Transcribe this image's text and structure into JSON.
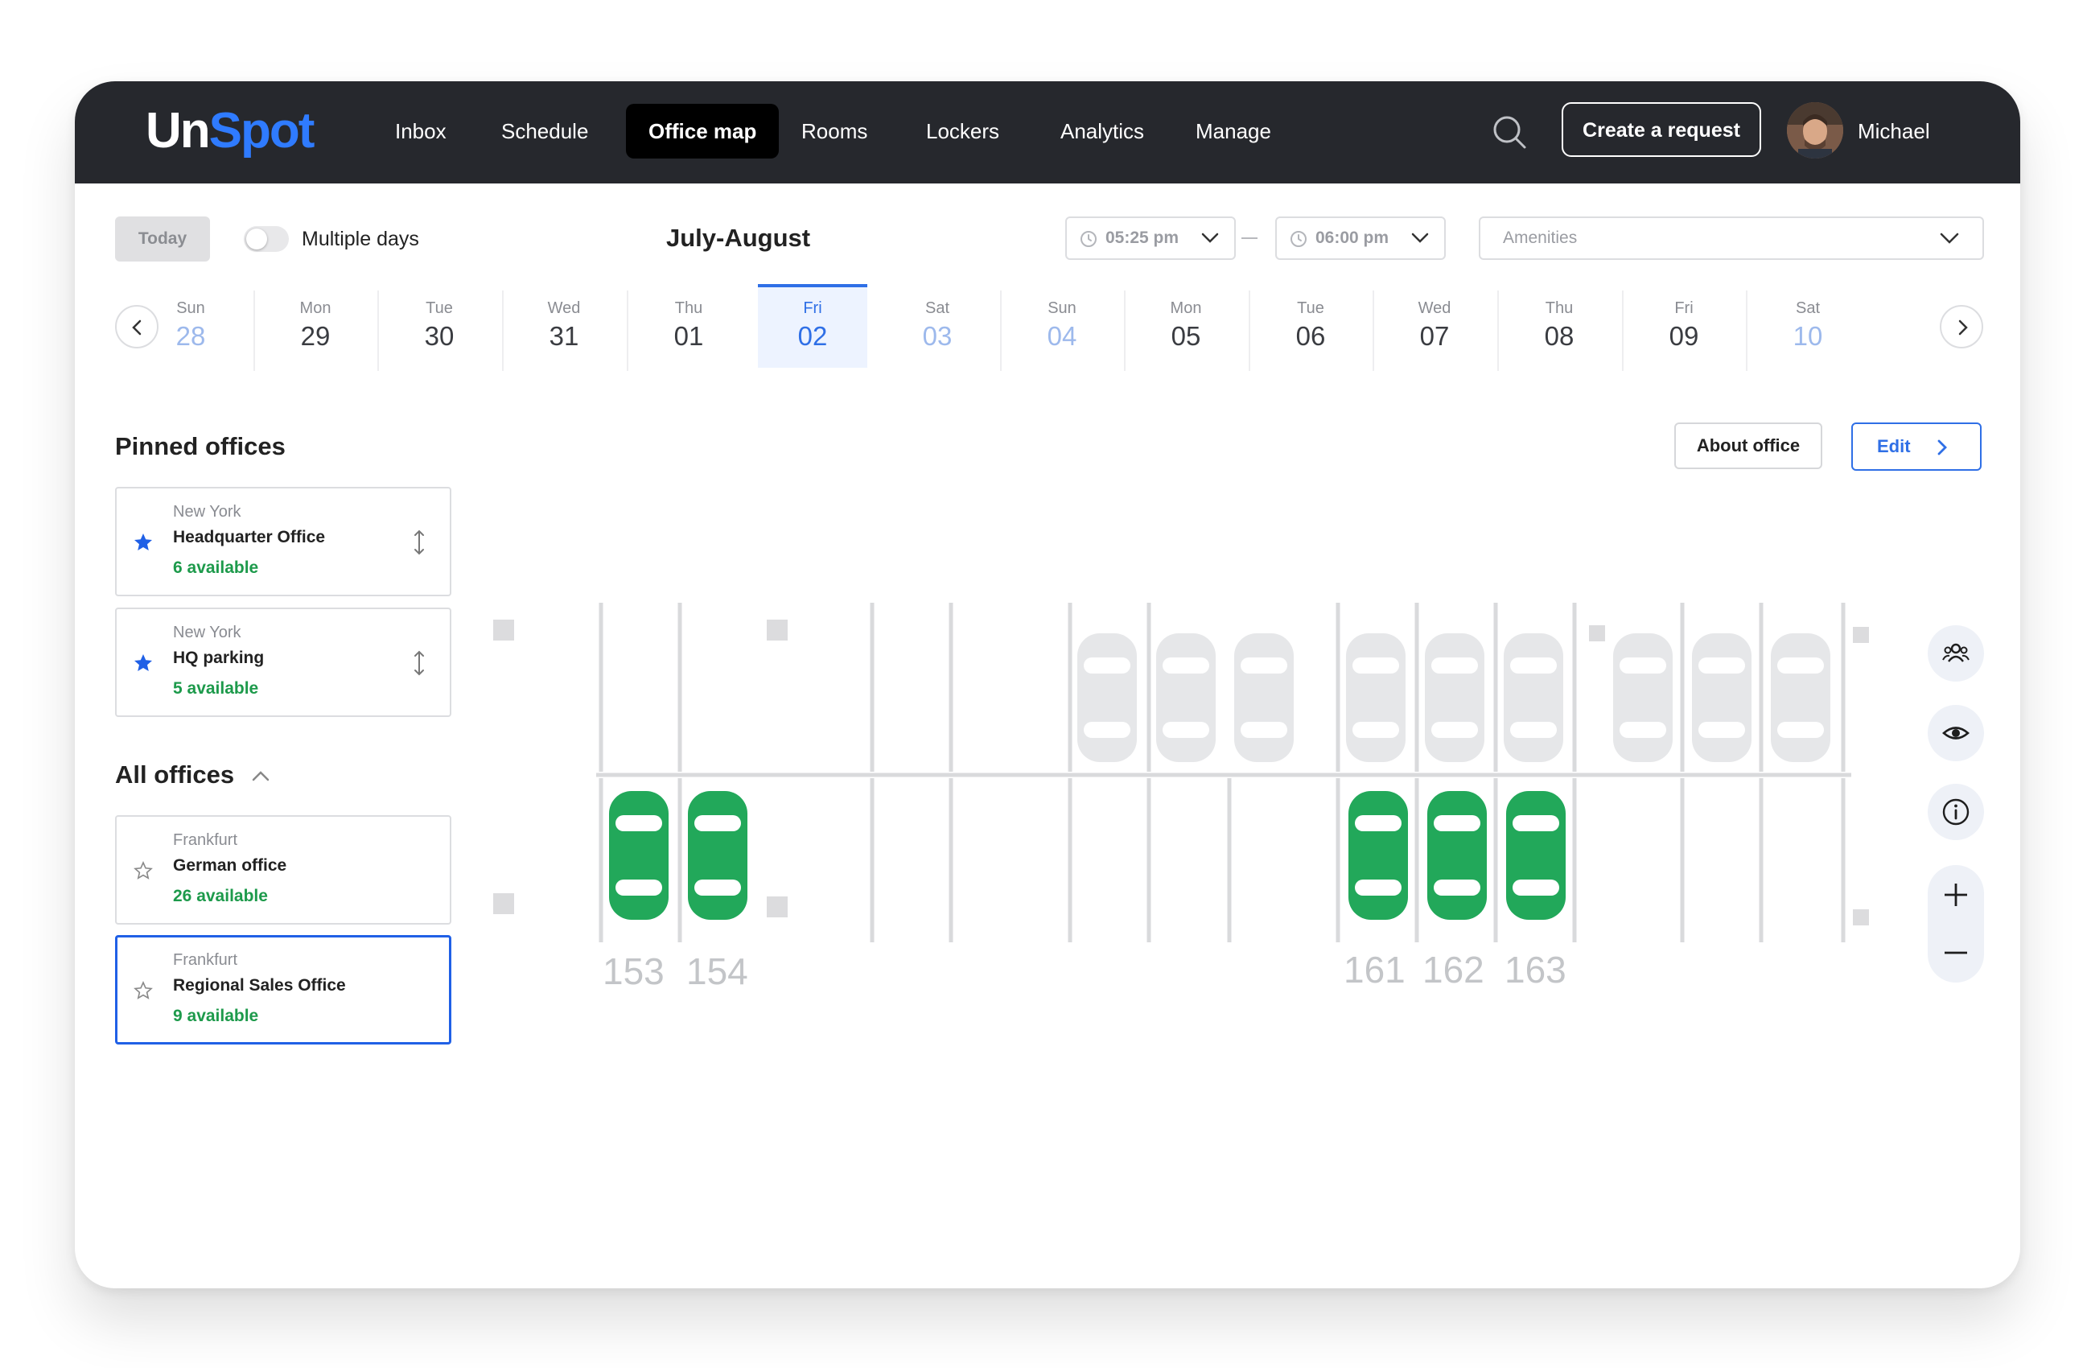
{
  "header": {
    "logo_un": "Un",
    "logo_spot": "Spot",
    "nav": [
      {
        "label": "Inbox"
      },
      {
        "label": "Schedule"
      },
      {
        "label": "Office map"
      },
      {
        "label": "Rooms"
      },
      {
        "label": "Lockers"
      },
      {
        "label": "Analytics"
      },
      {
        "label": "Manage"
      }
    ],
    "active_nav": "Office map",
    "create_label": "Create a request",
    "user_name": "Michael"
  },
  "toolbar": {
    "today_label": "Today",
    "multiple_days_label": "Multiple days",
    "multiple_days_on": false,
    "month_label": "July-August",
    "time_from": "05:25 pm",
    "time_to": "06:00 pm",
    "amenities_placeholder": "Amenities"
  },
  "dates": [
    {
      "day": "Sun",
      "date": "28",
      "weekend": true
    },
    {
      "day": "Mon",
      "date": "29"
    },
    {
      "day": "Tue",
      "date": "30"
    },
    {
      "day": "Wed",
      "date": "31"
    },
    {
      "day": "Thu",
      "date": "01"
    },
    {
      "day": "Fri",
      "date": "02",
      "selected": true
    },
    {
      "day": "Sat",
      "date": "03",
      "weekend": true
    },
    {
      "day": "Sun",
      "date": "04",
      "weekend": true
    },
    {
      "day": "Mon",
      "date": "05"
    },
    {
      "day": "Tue",
      "date": "06"
    },
    {
      "day": "Wed",
      "date": "07"
    },
    {
      "day": "Thu",
      "date": "08"
    },
    {
      "day": "Fri",
      "date": "09"
    },
    {
      "day": "Sat",
      "date": "10",
      "weekend": true
    }
  ],
  "pinned": {
    "title": "Pinned offices",
    "offices": [
      {
        "city": "New York",
        "name": "Headquarter Office",
        "available": "6 available"
      },
      {
        "city": "New York",
        "name": "HQ parking",
        "available": "5 available"
      }
    ]
  },
  "all_offices": {
    "title": "All offices",
    "offices": [
      {
        "city": "Frankfurt",
        "name": "German office",
        "available": "26 available"
      },
      {
        "city": "Frankfurt",
        "name": "Regional Sales Office",
        "available": "9 available",
        "selected": true
      }
    ]
  },
  "map": {
    "about_label": "About office",
    "edit_label": "Edit",
    "spot_labels": [
      "153",
      "154",
      "161",
      "162",
      "163"
    ]
  },
  "colors": {
    "header_bg": "#26282d",
    "accent": "#2f6fe6",
    "available_green": "#22a85a",
    "occupied_grey": "#e6e7e9"
  }
}
